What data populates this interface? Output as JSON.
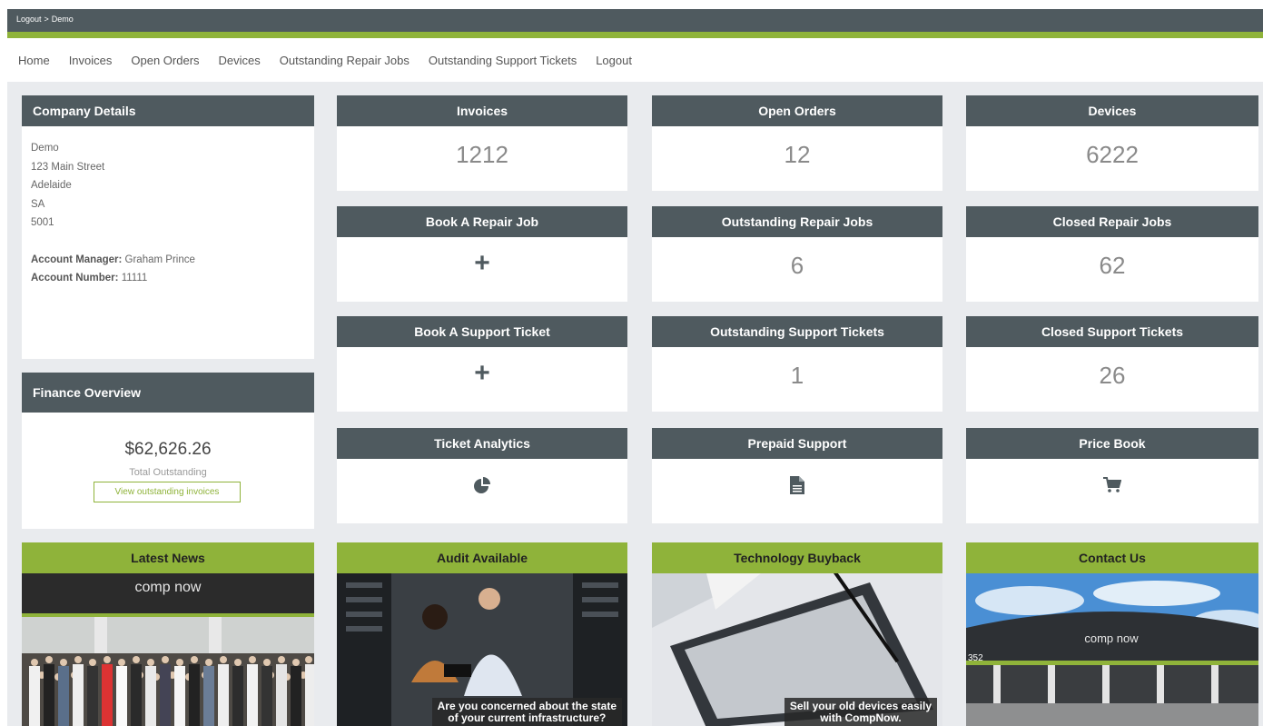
{
  "breadcrumb": {
    "logout": "Logout",
    "separator": ">",
    "current": "Demo"
  },
  "nav": [
    "Home",
    "Invoices",
    "Open Orders",
    "Devices",
    "Outstanding Repair Jobs",
    "Outstanding Support Tickets",
    "Logout"
  ],
  "company": {
    "title": "Company Details",
    "lines": [
      "Demo",
      "123 Main Street",
      "Adelaide",
      "SA",
      "5001"
    ],
    "manager_label": "Account Manager:",
    "manager": "Graham Prince",
    "number_label": "Account Number:",
    "number": "11111"
  },
  "finance": {
    "title": "Finance Overview",
    "amount": "$62,626.26",
    "label": "Total Outstanding",
    "button": "View outstanding invoices"
  },
  "tiles": {
    "invoices": {
      "title": "Invoices",
      "value": "1212"
    },
    "open_orders": {
      "title": "Open Orders",
      "value": "12"
    },
    "devices": {
      "title": "Devices",
      "value": "6222"
    },
    "book_repair": {
      "title": "Book A Repair Job",
      "icon": "plus-icon",
      "glyph": "+"
    },
    "outstanding_repairs": {
      "title": "Outstanding Repair Jobs",
      "value": "6"
    },
    "closed_repairs": {
      "title": "Closed Repair Jobs",
      "value": "62"
    },
    "book_ticket": {
      "title": "Book A Support Ticket",
      "icon": "plus-icon",
      "glyph": "+"
    },
    "outstanding_tickets": {
      "title": "Outstanding Support Tickets",
      "value": "1"
    },
    "closed_tickets": {
      "title": "Closed Support Tickets",
      "value": "26"
    },
    "analytics": {
      "title": "Ticket Analytics",
      "icon": "pie-chart-icon"
    },
    "prepaid": {
      "title": "Prepaid Support",
      "icon": "document-icon"
    },
    "price_book": {
      "title": "Price Book",
      "icon": "shopping-cart-icon"
    }
  },
  "news": {
    "latest": {
      "title": "Latest News",
      "logo_text": "comp now"
    },
    "audit": {
      "title": "Audit Available",
      "caption_1": "Are you concerned about the state",
      "caption_2": "of your current infrastructure?"
    },
    "buyback": {
      "title": "Technology Buyback",
      "caption_1": "Sell your old devices easily",
      "caption_2": "with CompNow."
    },
    "contact": {
      "title": "Contact Us",
      "logo_text": "comp now",
      "street_number": "352"
    }
  },
  "colors": {
    "header": "#4f5a5f",
    "accent": "#8fb33a",
    "background": "#e9ebee"
  }
}
